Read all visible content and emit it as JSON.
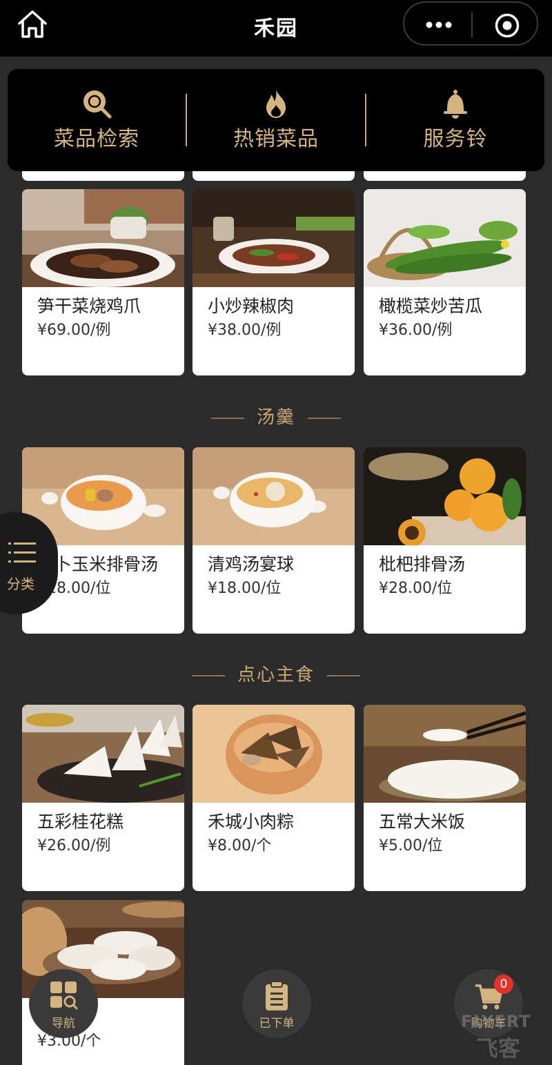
{
  "nav": {
    "title": "禾园"
  },
  "quick_actions": [
    {
      "label": "菜品检索",
      "icon": "search-icon"
    },
    {
      "label": "热销菜品",
      "icon": "fire-icon"
    },
    {
      "label": "服务铃",
      "icon": "bell-icon"
    }
  ],
  "sections": [
    {
      "title": "",
      "dishes": [
        {
          "name": "笋干菜烧鸡爪",
          "price": "¥69.00/例"
        },
        {
          "name": "小炒辣椒肉",
          "price": "¥38.00/例"
        },
        {
          "name": "橄榄菜炒苦瓜",
          "price": "¥36.00/例"
        }
      ]
    },
    {
      "title": "汤羹",
      "dishes": [
        {
          "name": "萝卜玉米排骨汤",
          "price": "¥18.00/位"
        },
        {
          "name": "清鸡汤宴球",
          "price": "¥18.00/位"
        },
        {
          "name": "枇杷排骨汤",
          "price": "¥28.00/位"
        }
      ]
    },
    {
      "title": "点心主食",
      "dishes": [
        {
          "name": "五彩桂花糕",
          "price": "¥26.00/例"
        },
        {
          "name": "禾城小肉粽",
          "price": "¥8.00/个"
        },
        {
          "name": "五常大米饭",
          "price": "¥5.00/位"
        },
        {
          "name": "",
          "price": "¥3.00/个"
        }
      ]
    }
  ],
  "floating": {
    "category_label": "分类",
    "nav_label": "导航",
    "orders_label": "已下单",
    "cart_label": "购物车",
    "cart_count": "0"
  },
  "watermark": {
    "line1": "FLYERT",
    "line2": "飞客"
  },
  "colors": {
    "gold": "#d4b57f",
    "background": "#2b2b2b",
    "badge": "#e0322b"
  }
}
